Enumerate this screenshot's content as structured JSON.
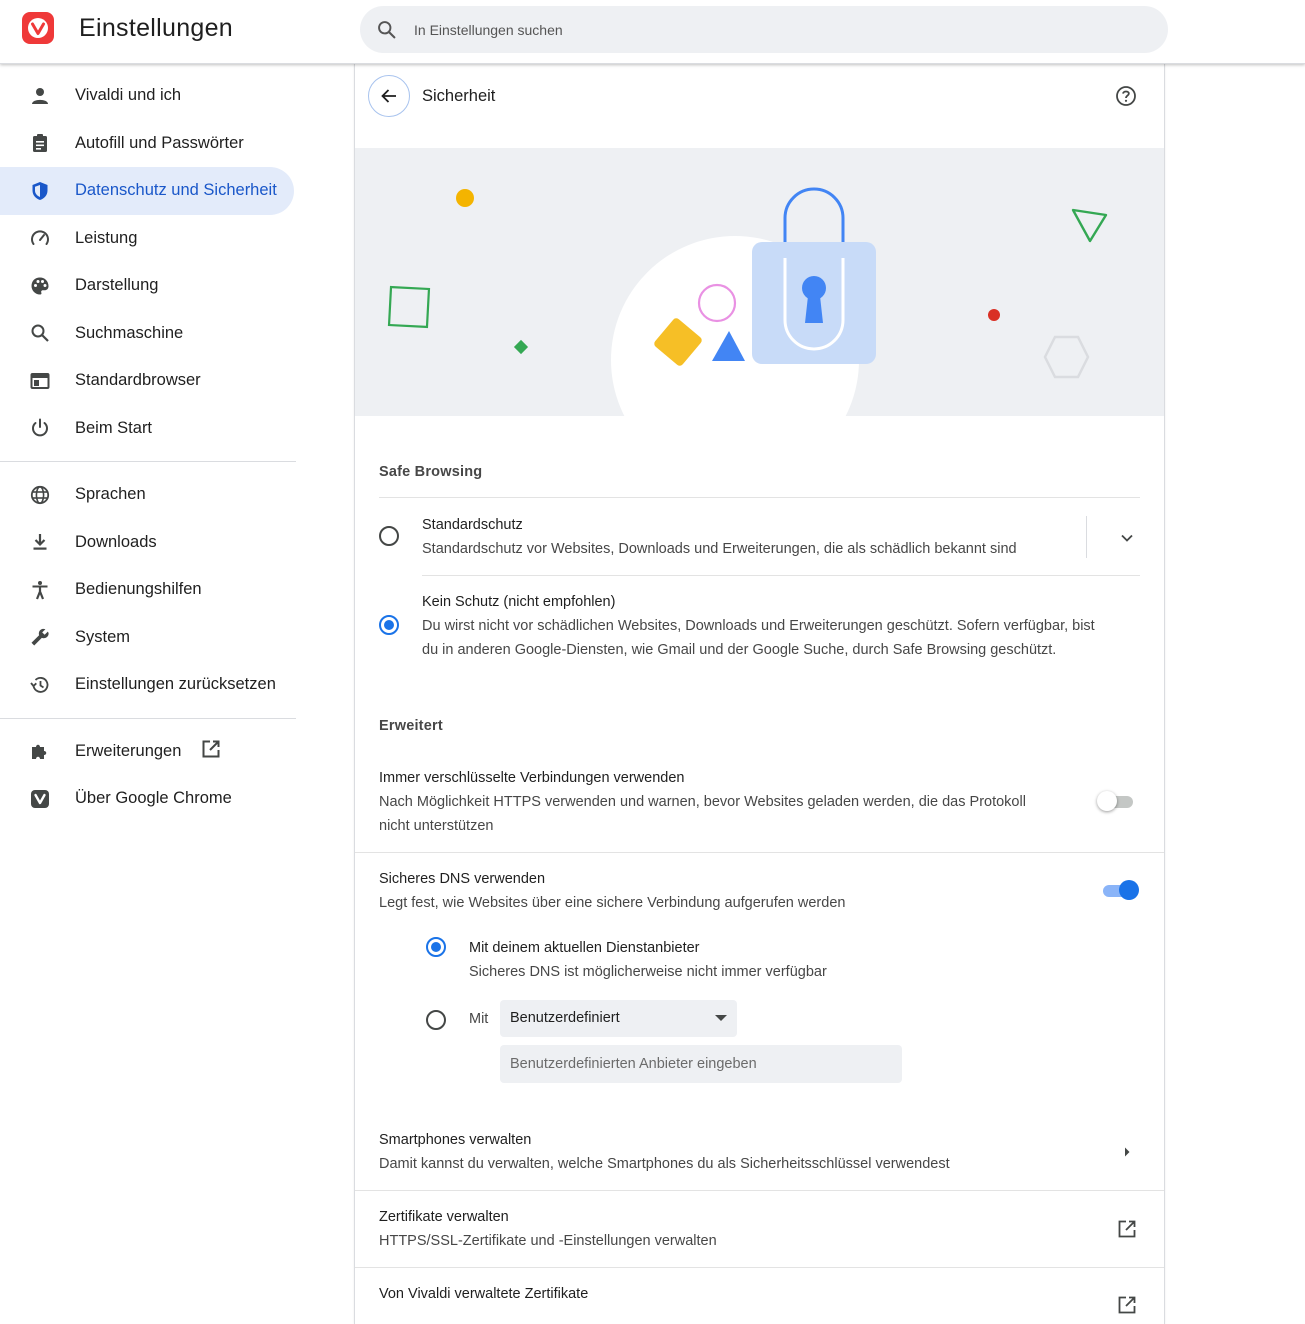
{
  "app": {
    "title": "Einstellungen"
  },
  "search": {
    "placeholder": "In Einstellungen suchen"
  },
  "sidebar": {
    "items": [
      {
        "label": "Vivaldi und ich"
      },
      {
        "label": "Autofill und Passwörter"
      },
      {
        "label": "Datenschutz und Sicherheit",
        "active": true
      },
      {
        "label": "Leistung"
      },
      {
        "label": "Darstellung"
      },
      {
        "label": "Suchmaschine"
      },
      {
        "label": "Standardbrowser"
      },
      {
        "label": "Beim Start"
      },
      {
        "label": "Sprachen"
      },
      {
        "label": "Downloads"
      },
      {
        "label": "Bedienungshilfen"
      },
      {
        "label": "System"
      },
      {
        "label": "Einstellungen zurücksetzen"
      },
      {
        "label": "Erweiterungen"
      },
      {
        "label": "Über Google Chrome"
      }
    ]
  },
  "page": {
    "title": "Sicherheit"
  },
  "safe_browsing": {
    "heading": "Safe Browsing",
    "options": [
      {
        "title": "Standardschutz",
        "description": "Standardschutz vor Websites, Downloads und Erweiterungen, die als schädlich bekannt sind",
        "checked": false
      },
      {
        "title": "Kein Schutz (nicht empfohlen)",
        "description_line1": "Du wirst nicht vor schädlichen Websites, Downloads und Erweiterungen geschützt. Sofern verfügbar, bist",
        "description_line2": "du in anderen Google-Diensten, wie Gmail und der Google Suche, durch Safe Browsing geschützt.",
        "checked": true
      }
    ]
  },
  "advanced": {
    "heading": "Erweitert",
    "https": {
      "title": "Immer verschlüsselte Verbindungen verwenden",
      "description_line1": "Nach Möglichkeit HTTPS verwenden und warnen, bevor Websites geladen werden, die das Protokoll",
      "description_line2": "nicht unterstützen",
      "enabled": false
    },
    "dns": {
      "title": "Sicheres DNS verwenden",
      "description": "Legt fest, wie Websites über eine sichere Verbindung aufgerufen werden",
      "enabled": true,
      "option_current": {
        "title": "Mit deinem aktuellen Dienstanbieter",
        "description": "Sicheres DNS ist möglicherweise nicht immer verfügbar",
        "checked": true
      },
      "option_custom": {
        "prefix": "Mit",
        "selected": "Benutzerdefiniert",
        "input_placeholder": "Benutzerdefinierten Anbieter eingeben",
        "checked": false
      }
    },
    "phones": {
      "title": "Smartphones verwalten",
      "description": "Damit kannst du verwalten, welche Smartphones du als Sicherheitsschlüssel verwendest"
    },
    "certs": {
      "title": "Zertifikate verwalten",
      "description": "HTTPS/SSL-Zertifikate und -Einstellungen verwalten"
    },
    "vivaldi_certs": {
      "title": "Von Vivaldi verwaltete Zertifikate"
    }
  },
  "colors": {
    "accent": "#1a73e8",
    "active_nav_bg": "#e3ebfa",
    "active_nav_text": "#1a57c9",
    "brand": "#ef3939",
    "banner_bg": "#eef0f3"
  }
}
